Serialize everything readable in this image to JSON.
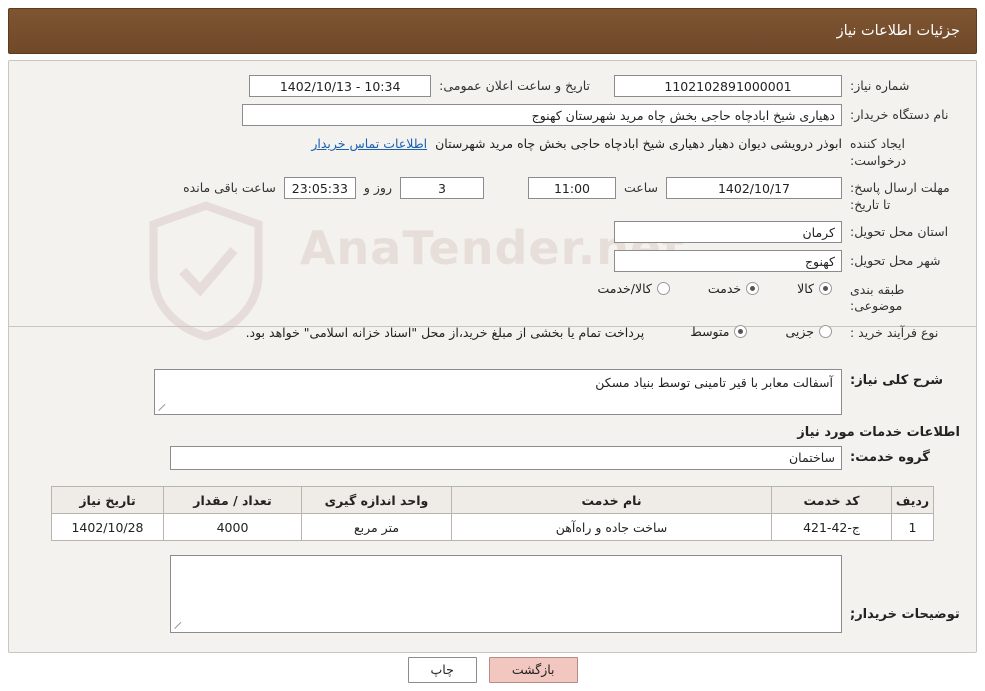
{
  "header": {
    "title": "جزئیات اطلاعات نیاز"
  },
  "watermark": {
    "text": "AnaTender.net"
  },
  "fields": {
    "need_number_label": "شماره نیاز:",
    "need_number_value": "1102102891000001",
    "announce_datetime_label": "تاریخ و ساعت اعلان عمومی:",
    "announce_datetime_value": "10:34 - 1402/10/13",
    "buyer_org_label": "نام دستگاه خریدار:",
    "buyer_org_value": "دهیاری شیخ ابادچاه حاجی بخش چاه مرید شهرستان کهنوج",
    "requester_label": "ایجاد کننده درخواست:",
    "requester_value": "ابوذر درویشی دیوان دهیار دهیاری شیخ ابادچاه حاجی بخش چاه مرید شهرستان",
    "requester_link": "اطلاعات تماس خریدار",
    "deadline_label": "مهلت ارسال پاسخ: تا تاریخ:",
    "deadline_date_value": "1402/10/17",
    "deadline_hour_label": "ساعت",
    "deadline_hour_value": "11:00",
    "remaining_days_value": "3",
    "remaining_days_label": "روز و",
    "remaining_time_value": "23:05:33",
    "remaining_suffix_label": "ساعت باقی مانده",
    "province_label": "استان محل تحویل:",
    "province_value": "کرمان",
    "city_label": "شهر محل تحویل:",
    "city_value": "کهنوج",
    "category_label": "طبقه بندی موضوعی:",
    "purchase_type_label": "نوع فرآیند خرید :",
    "payment_note": "پرداخت تمام یا بخشی از مبلغ خرید،از محل \"اسناد خزانه اسلامی\" خواهد بود."
  },
  "category_options": [
    {
      "label": "کالا",
      "checked": true
    },
    {
      "label": "خدمت",
      "checked": true
    },
    {
      "label": "کالا/خدمت",
      "checked": false
    }
  ],
  "purchase_options": [
    {
      "label": "جزیی",
      "checked": false
    },
    {
      "label": "متوسط",
      "checked": true
    }
  ],
  "general_desc": {
    "label": "شرح کلی نیاز:",
    "value": "آسفالت معابر با قیر تامینی توسط بنیاد مسکن"
  },
  "services_section": {
    "title": "اطلاعات خدمات مورد نیاز",
    "group_label": "گروه خدمت:",
    "group_value": "ساختمان"
  },
  "table": {
    "headers": [
      "ردیف",
      "کد خدمت",
      "نام خدمت",
      "واحد اندازه گیری",
      "تعداد / مقدار",
      "تاریخ نیاز"
    ],
    "rows": [
      {
        "row": "1",
        "code": "ج-42-421",
        "name": "ساخت جاده و راه‌آهن",
        "unit": "متر مربع",
        "qty": "4000",
        "date": "1402/10/28"
      }
    ]
  },
  "buyer_notes": {
    "label": "توضیحات خریدار;",
    "value": ""
  },
  "footer": {
    "print_label": "چاپ",
    "back_label": "بازگشت"
  }
}
